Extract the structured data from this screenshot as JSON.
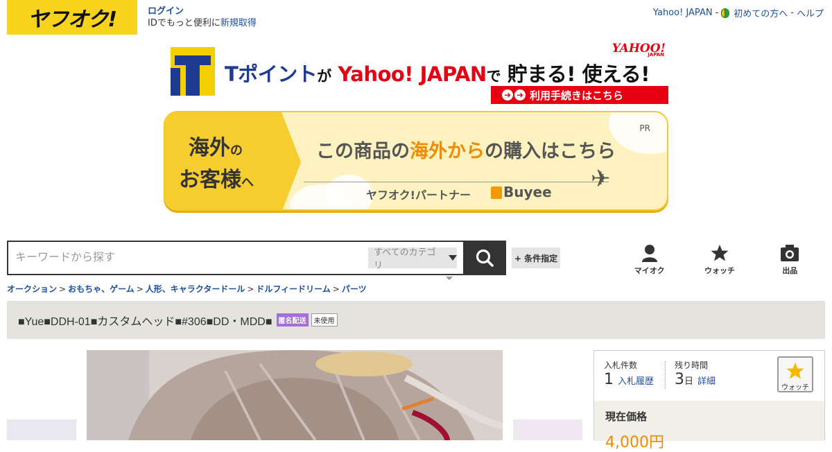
{
  "header": {
    "logo_text": "ヤフオク!",
    "login_label": "ログイン",
    "login_sub_prefix": "IDでもっと便利に",
    "register_label": "新規取得",
    "links": [
      "Yahoo! JAPAN",
      "初めての方へ",
      "ヘルプ"
    ],
    "sep": "-"
  },
  "tpoint_banner": {
    "part1": "Tポイント",
    "part2": "が",
    "part3": "Yahoo! JAPAN",
    "part4": "で",
    "part5": "貯まる! 使える!",
    "yj_logo": "YAHOO!",
    "yj_sub": "JAPAN",
    "procedure": "利用手続きはこちら"
  },
  "overseas_banner": {
    "left_line1_main": "海外",
    "left_line1_small": "の",
    "left_line2_main": "お客様",
    "left_line2_small": "へ",
    "pr": "PR",
    "text_before": "この商品の",
    "text_highlight": "海外から",
    "text_after": "の購入はこちら",
    "partner": "ヤフオク!パートナー",
    "buyee": "Buyee"
  },
  "search": {
    "placeholder": "キーワードから探す",
    "category": "すべてのカテゴリ",
    "condition_label": "+ 条件指定"
  },
  "nav": {
    "myauc": "マイオク",
    "watch": "ウォッチ",
    "sell": "出品"
  },
  "breadcrumb": {
    "items": [
      "オークション",
      "おもちゃ、ゲーム",
      "人形、キャラクタードール",
      "ドルフィードリーム",
      "パーツ"
    ],
    "sep": ">"
  },
  "item": {
    "title": "■Yue■DDH-01■カスタムヘッド■#306■DD・MDD■",
    "badge_anonymous": "匿名配送",
    "badge_unused": "未使用"
  },
  "info": {
    "bids_label": "入札件数",
    "bids_value": "1",
    "bids_link": "入札履歴",
    "time_label": "残り時間",
    "time_value": "3",
    "time_unit": "日",
    "time_link": "詳細",
    "watch_label": "ウォッチ",
    "price_label": "現在価格",
    "price_value": "4,000円"
  },
  "colors": {
    "brand_yellow": "#f8d21c",
    "link_blue": "#1a4fa3",
    "accent_orange": "#f08a00",
    "tpoint_red": "#e60012"
  }
}
